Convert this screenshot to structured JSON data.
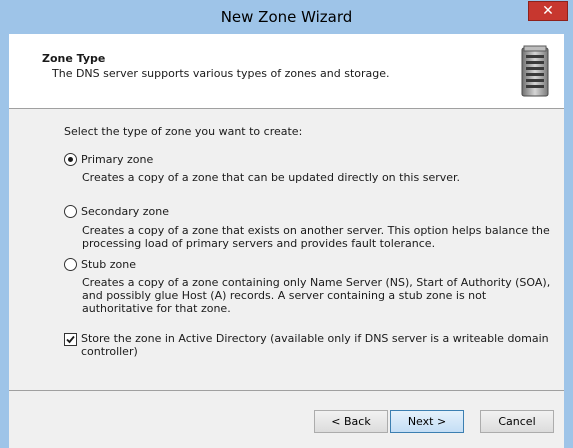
{
  "window": {
    "title": "New Zone Wizard"
  },
  "header": {
    "title": "Zone Type",
    "subtitle": "The DNS server supports various types of zones and storage.",
    "icon": "server-icon"
  },
  "content": {
    "prompt": "Select the type of zone you want to create:",
    "options": [
      {
        "label": "Primary zone",
        "selected": true,
        "description": "Creates a copy of a zone that can be updated directly on this server."
      },
      {
        "label": "Secondary zone",
        "selected": false,
        "description": "Creates a copy of a zone that exists on another server. This option helps balance the processing load of primary servers and provides fault tolerance."
      },
      {
        "label": "Stub zone",
        "selected": false,
        "description": "Creates a copy of a zone containing only Name Server (NS), Start of Authority (SOA), and possibly glue Host (A) records. A server containing a stub zone is not authoritative for that zone."
      }
    ],
    "store_in_ad": {
      "label": "Store the zone in Active Directory (available only if DNS server is a writeable domain controller)",
      "checked": true
    }
  },
  "footer": {
    "back_label": "< Back",
    "next_label": "Next >",
    "cancel_label": "Cancel"
  },
  "colors": {
    "titlebar": "#9ec4e8",
    "close": "#c7372f",
    "dialog_bg": "#f0f0f0"
  }
}
